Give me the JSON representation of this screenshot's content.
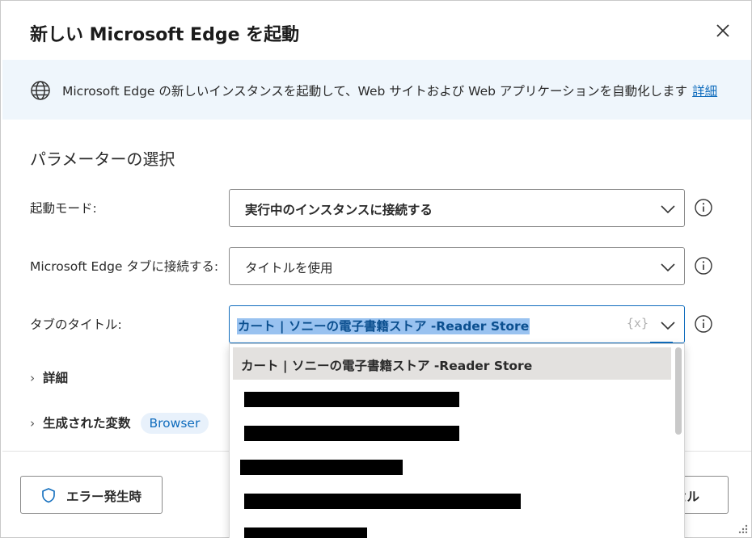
{
  "dialog": {
    "title": "新しい Microsoft Edge を起動",
    "close_icon": "close-icon"
  },
  "info": {
    "text": "Microsoft Edge の新しいインスタンスを起動して、Web サイトおよび Web アプリケーションを自動化します",
    "link": "詳細",
    "icon": "globe-icon"
  },
  "section_title": "パラメーターの選択",
  "fields": {
    "launch_mode": {
      "label": "起動モード:",
      "value": "実行中のインスタンスに接続する"
    },
    "attach_tab": {
      "label": "Microsoft Edge タブに接続する:",
      "value": "タイトルを使用"
    },
    "tab_title": {
      "label": "タブのタイトル:",
      "value": "カート | ソニーの電子書籍ストア -Reader Store",
      "variable_token": "{x}"
    }
  },
  "dropdown": {
    "items": [
      {
        "label": "カート | ソニーの電子書籍ストア -Reader Store",
        "redacted": false,
        "selected": true
      },
      {
        "label": "",
        "redacted": true
      },
      {
        "label": "",
        "redacted": true
      },
      {
        "label": "",
        "redacted": true
      },
      {
        "label": "",
        "redacted": true
      },
      {
        "label": "",
        "redacted": true
      }
    ]
  },
  "expanders": {
    "details": "詳細",
    "generated_variables": "生成された変数",
    "variable_chip": "Browser"
  },
  "footer": {
    "error_button": "エラー発生時",
    "cancel_button": "セル"
  },
  "colors": {
    "accent": "#0f6cbd",
    "info_bg": "#eff6fc",
    "selected_item_bg": "#e3e1df"
  }
}
